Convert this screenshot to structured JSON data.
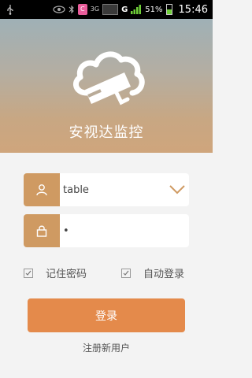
{
  "status_bar": {
    "network_3g": "3G",
    "network_g": "G",
    "battery_percent": "51%",
    "time": "15:46"
  },
  "app": {
    "title": "安视达监控"
  },
  "login": {
    "username_value": "table",
    "password_value": "•",
    "remember_label": "记住密码",
    "auto_login_label": "自动登录",
    "login_button": "登录",
    "register_link": "注册新用户"
  },
  "colors": {
    "accent": "#e48a4b",
    "icon_bg": "#cf9a62",
    "background": "#f3f3f3"
  },
  "icons": [
    "usb-icon",
    "eye-icon",
    "bluetooth-icon",
    "app-notification-icon",
    "signal-icon",
    "battery-icon",
    "cloud-camera-icon",
    "user-icon",
    "lock-icon",
    "chevron-down-icon",
    "checkbox-icon"
  ]
}
